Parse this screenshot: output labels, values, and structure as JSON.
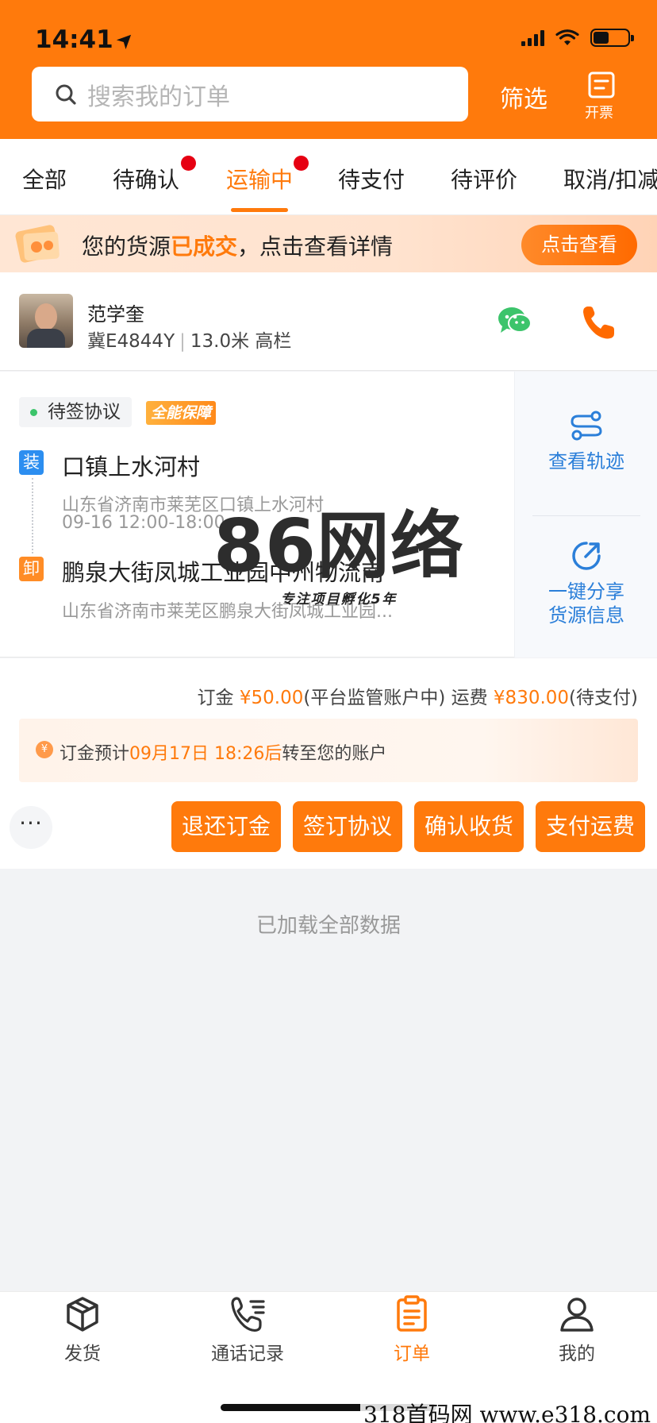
{
  "status_bar": {
    "time": "14:41",
    "location_icon": "location-arrow-icon",
    "battery_level": 0.45
  },
  "header": {
    "search_placeholder": "搜索我的订单",
    "filter_label": "筛选",
    "invoice_label": "开票"
  },
  "tabs": [
    {
      "label": "全部",
      "badge": false
    },
    {
      "label": "待确认",
      "badge": true
    },
    {
      "label": "运输中",
      "badge": true,
      "active": true
    },
    {
      "label": "待支付",
      "badge": false
    },
    {
      "label": "待评价",
      "badge": false
    },
    {
      "label": "取消/扣减",
      "badge": false
    }
  ],
  "banner": {
    "text_before": "您的货源",
    "text_highlight": "已成交",
    "text_after": "，点击查看详情",
    "button_label": "点击查看"
  },
  "driver": {
    "name": "范学奎",
    "plate": "冀E4844Y",
    "vehicle": "13.0米 高栏"
  },
  "order": {
    "status": "待签协议",
    "guarantee": "全能保障",
    "load_tag": "装",
    "load_title": "口镇上水河村",
    "load_address": "山东省济南市莱芜区口镇上水河村",
    "load_time": "09-16 12:00-18:00",
    "unload_tag": "卸",
    "unload_title": "鹏泉大街凤城工业园中州物流南",
    "unload_address": "山东省济南市莱芜区鹏泉大街凤城工业园...",
    "track_label": "查看轨迹",
    "share_label_1": "一键分享",
    "share_label_2": "货源信息"
  },
  "watermark": {
    "title": "86网络",
    "subtitle": "专注项目孵化5年"
  },
  "payment": {
    "deposit_label": "订金",
    "deposit_amount": "¥50.00",
    "deposit_status": "(平台监管账户中)",
    "freight_label": "运费",
    "freight_amount": "¥830.00",
    "freight_status": "(待支付)",
    "notice_icon": "¥",
    "notice_before": "订金预计",
    "notice_time": "09月17日 18:26后",
    "notice_after": "转至您的账户",
    "more_label": "···",
    "actions": [
      "退还订金",
      "签订协议",
      "确认收货",
      "支付运费"
    ]
  },
  "list_footer": "已加载全部数据",
  "bottom_nav": [
    {
      "label": "发货",
      "icon": "box-icon"
    },
    {
      "label": "通话记录",
      "icon": "phone-list-icon"
    },
    {
      "label": "订单",
      "icon": "clipboard-icon",
      "active": true
    },
    {
      "label": "我的",
      "icon": "user-icon"
    }
  ],
  "site_watermark": "318首码网  www.e318.com",
  "colors": {
    "brand": "#ff7a0c",
    "link": "#2b7fd9",
    "badge": "#e60012",
    "wechat": "#3cc46b"
  }
}
